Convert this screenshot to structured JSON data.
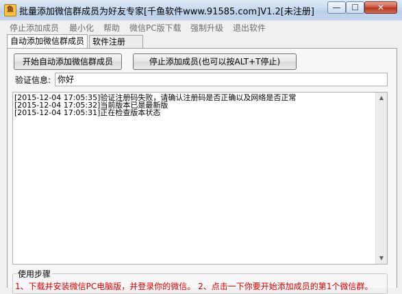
{
  "window": {
    "title": "批量添加微信群成员为好友专家[千鱼软件www.91585.com]V1.2[未注册]",
    "icon_label": "鱼",
    "controls": {
      "minimize": "—",
      "maximize": "☐",
      "close": "✕"
    }
  },
  "menu": {
    "items": [
      {
        "label": "停止添加成员"
      },
      {
        "label": "最小化"
      },
      {
        "label": "帮助"
      },
      {
        "label": "微信PC版下载"
      },
      {
        "label": "强制升级"
      },
      {
        "label": "退出软件"
      }
    ]
  },
  "tabs": [
    {
      "label": "自动添加微信群成员",
      "active": true
    },
    {
      "label": "软件注册",
      "active": false
    }
  ],
  "buttons": {
    "start": "开始自动添加微信群成员",
    "stop": "停止添加成员(也可以按ALT+T停止)"
  },
  "verify": {
    "label": "验证信息:",
    "value": "你好"
  },
  "log": {
    "lines": [
      "[2015-12-04 17:05:35]验证注册码失败，请确认注册码是否正确以及网络是否正常",
      "[2015-12-04 17:05:32]当前版本已是最新版",
      "[2015-12-04 17:05:31]正在检查版本状态"
    ]
  },
  "usage": {
    "title": "使用步骤",
    "steps_text": "1、下载并安装微信PC电脑版，并登录你的微信。 2、点击一下你要开始添加成员的第1个微信群。"
  },
  "colors": {
    "steps_text": "#e00000",
    "menu_text": "#6d6d6d"
  }
}
